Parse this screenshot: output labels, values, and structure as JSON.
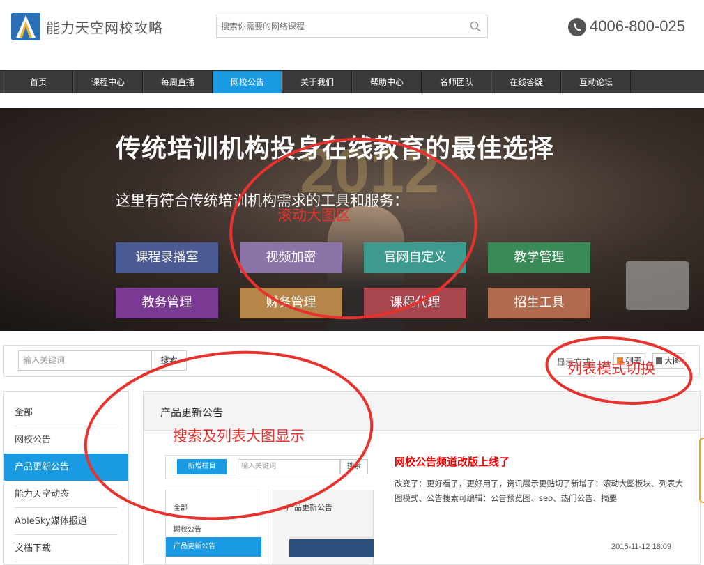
{
  "header": {
    "logo_text": "能力天空网校攻略",
    "search_placeholder": "搜索你需要的网络课程",
    "phone": "4006-800-025"
  },
  "nav": {
    "items": [
      "首页",
      "课程中心",
      "每周直播",
      "网校公告",
      "关于我们",
      "帮助中心",
      "名师团队",
      "在线答疑",
      "互动论坛"
    ],
    "active_index": 3
  },
  "banner": {
    "title": "传统培训机构投身在线教育的最佳选择",
    "subtitle": "这里有符合传统培训机构需求的工具和服务：",
    "tiles": [
      {
        "label": "课程录播室",
        "color": "#4a5a93"
      },
      {
        "label": "视频加密",
        "color": "#8a74a8"
      },
      {
        "label": "官网自定义",
        "color": "#3f9a8e"
      },
      {
        "label": "教学管理",
        "color": "#3a8a58"
      },
      {
        "label": "教务管理",
        "color": "#7a3a93"
      },
      {
        "label": "财务管理",
        "color": "#b5854a"
      },
      {
        "label": "课程代理",
        "color": "#a8464e"
      },
      {
        "label": "招生工具",
        "color": "#b06a4e"
      }
    ],
    "bg_text": "2012"
  },
  "filter": {
    "keyword_placeholder": "输入关键词",
    "search_btn": "搜索",
    "view_label": "显示方式：",
    "list_btn": "列表",
    "big_btn": "大图"
  },
  "sidebar": {
    "items": [
      "全部",
      "网校公告",
      "产品更新公告",
      "能力天空动态",
      "AbleSky媒体报道",
      "文档下载"
    ],
    "active_index": 2
  },
  "panel": {
    "title": "产品更新公告"
  },
  "thumb": {
    "new_btn": "新增栏目",
    "input_placeholder": "输入关键词",
    "search_btn": "搜索",
    "side_items": [
      "全部",
      "网校公告"
    ],
    "side_active": "产品更新公告",
    "panel_title": "产品更新公告"
  },
  "news": {
    "title": "网校公告频道改版上线了",
    "desc": "改变了：更好看了，更好用了，资讯展示更贴切了新增了：滚动大图板块、列表大图模式、公告搜索可编辑：公告预览图、seo、热门公告、摘要",
    "date": "2015-11-12 18:09"
  },
  "annotations": {
    "banner": "滚动大图区",
    "view_switch": "列表模式切换",
    "search_list": "搜索及列表大图显示",
    "color": "#e8322e"
  }
}
